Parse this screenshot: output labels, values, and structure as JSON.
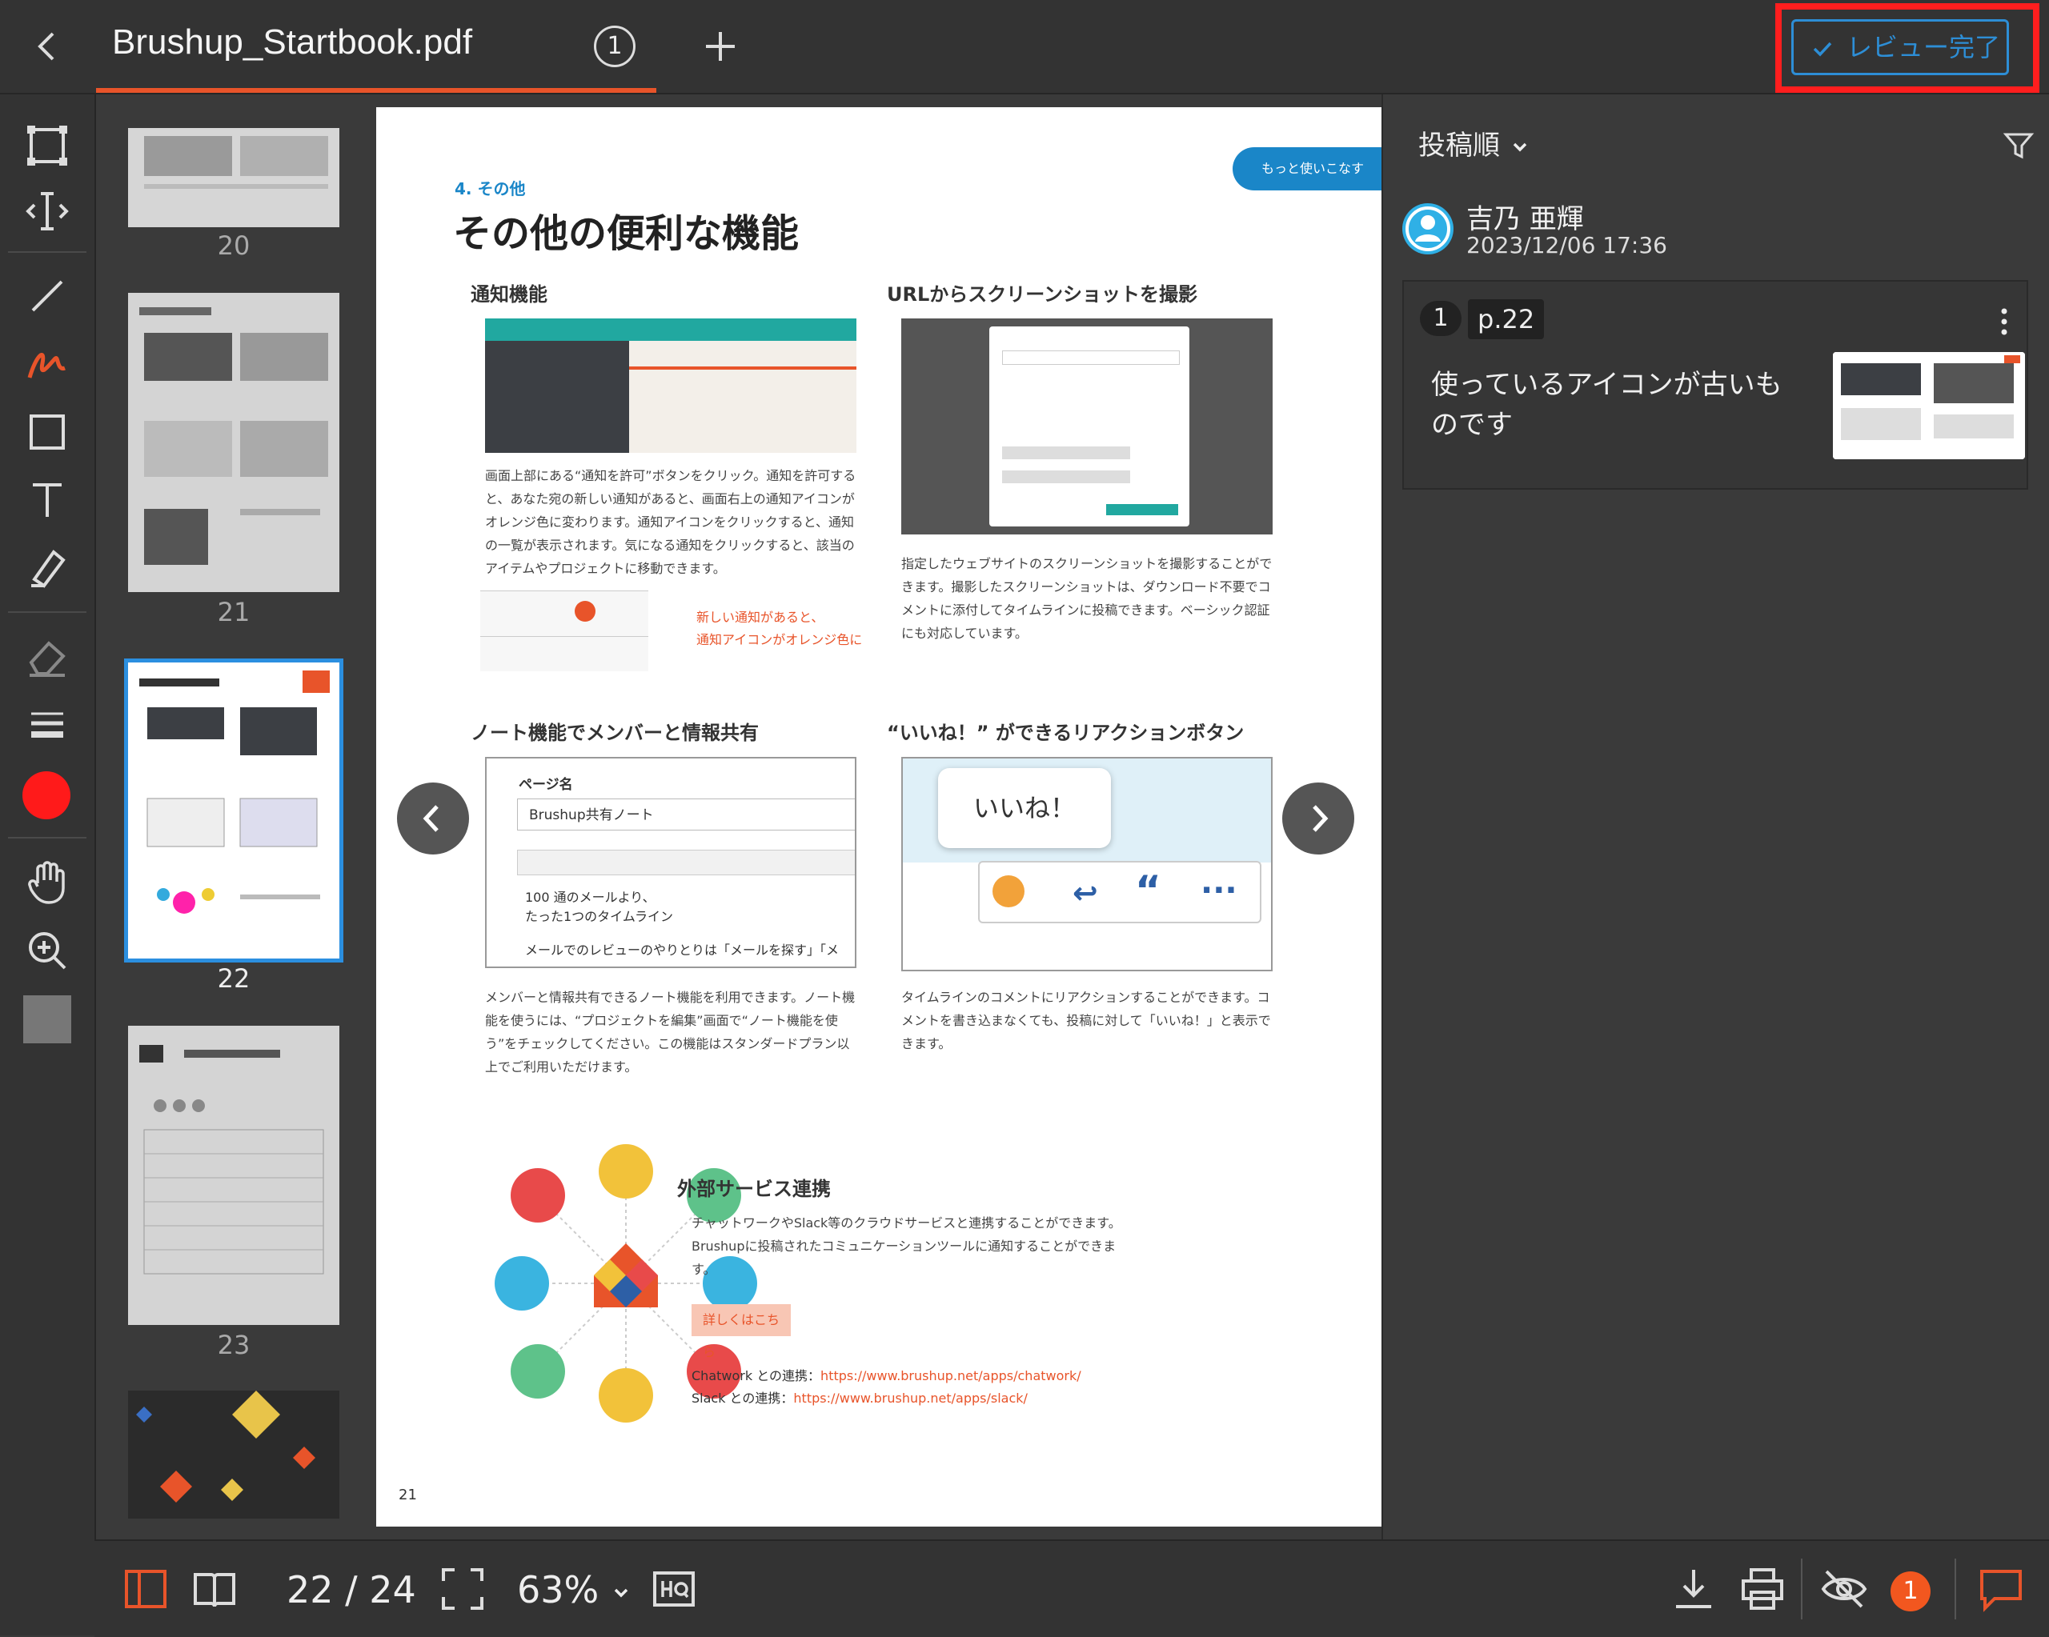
{
  "header": {
    "file_name": "Brushup_Startbook.pdf",
    "tab_count": "1",
    "review_button": "レビュー完了"
  },
  "icons": {
    "back": "chevron-left-icon",
    "add": "plus-icon",
    "tools": [
      "select-rectangle-icon",
      "text-cursor-icon",
      "line-icon",
      "freehand-pen-icon",
      "rectangle-icon",
      "text-tool-icon",
      "highlighter-icon",
      "eraser-icon",
      "stroke-width-icon",
      "color-picker",
      "hand-icon",
      "zoom-in-icon",
      "fill-color-swatch"
    ]
  },
  "colors": {
    "accent_orange": "#e8542a",
    "accent_blue": "#2d8ed6",
    "highlight_red": "#ff1e1e",
    "pen_color": "#ff1a1a"
  },
  "thumbnails": [
    {
      "label": "20"
    },
    {
      "label": "21"
    },
    {
      "label": "22"
    },
    {
      "label": "23"
    }
  ],
  "page": {
    "chapter": "4. その他",
    "title": "その他の便利な機能",
    "badge": "もっと使いこなす",
    "page_number": "21",
    "sections": {
      "notify_title": "通知機能",
      "notify_text": "画面上部にある“通知を許可”ボタンをクリック。通知を許可すると、あなた宛の新しい通知があると、画面右上の通知アイコンがオレンジ色に変わります。通知アイコンをクリックすると、通知の一覧が表示されます。気になる通知をクリックすると、該当のアイテムやプロジェクトに移動できます。",
      "notify_callout_1": "新しい通知があると、",
      "notify_callout_2": "通知アイコンがオレンジ色に",
      "url_title": "URLからスクリーンショットを撮影",
      "url_text": "指定したウェブサイトのスクリーンショットを撮影することができます。撮影したスクリーンショットは、ダウンロード不要でコメントに添付してタイムラインに投稿できます。ベーシック認証にも対応しています。",
      "note_title": "ノート機能でメンバーと情報共有",
      "note_page_label": "ページ名",
      "note_page_value": "Brushup共有ノート",
      "note_body_1": "100 通のメールより、",
      "note_body_2": "たった1つのタイムライン",
      "note_body_3": "メールでのレビューのやりとりは「メールを探す」「メ",
      "note_text": "メンバーと情報共有できるノート機能を利用できます。ノート機能を使うには、“プロジェクトを編集”画面で“ノート機能を使う”をチェックしてください。この機能はスタンダードプラン以上でご利用いただけます。",
      "like_title": "“いいね！” ができるリアクションボタン",
      "like_bubble": "いいね！",
      "like_text": "タイムラインのコメントにリアクションすることができます。コメントを書き込まなくても、投稿に対して「いいね！」と表示できます。",
      "ext_title": "外部サービス連携",
      "ext_text": "チャットワークやSlack等のクラウドサービスと連携することができます。Brushupに投稿されたコミュニケーションツールに通知することができます。",
      "ext_more": "詳しくはこちら",
      "ext_chatwork_label": "Chatwork との連携：",
      "ext_chatwork_url": "https://www.brushup.net/apps/chatwork/",
      "ext_slack_label": "Slack との連携：",
      "ext_slack_url": "https://www.brushup.net/apps/slack/"
    }
  },
  "panel": {
    "sort_label": "投稿順",
    "user_name": "吉乃 亜輝",
    "user_date": "2023/12/06 17:36",
    "comment": {
      "number": "1",
      "page": "p.22",
      "text": "使っているアイコンが古いものです"
    }
  },
  "bottom": {
    "page_counter": "22 / 24",
    "zoom": "63%",
    "notification_count": "1"
  }
}
